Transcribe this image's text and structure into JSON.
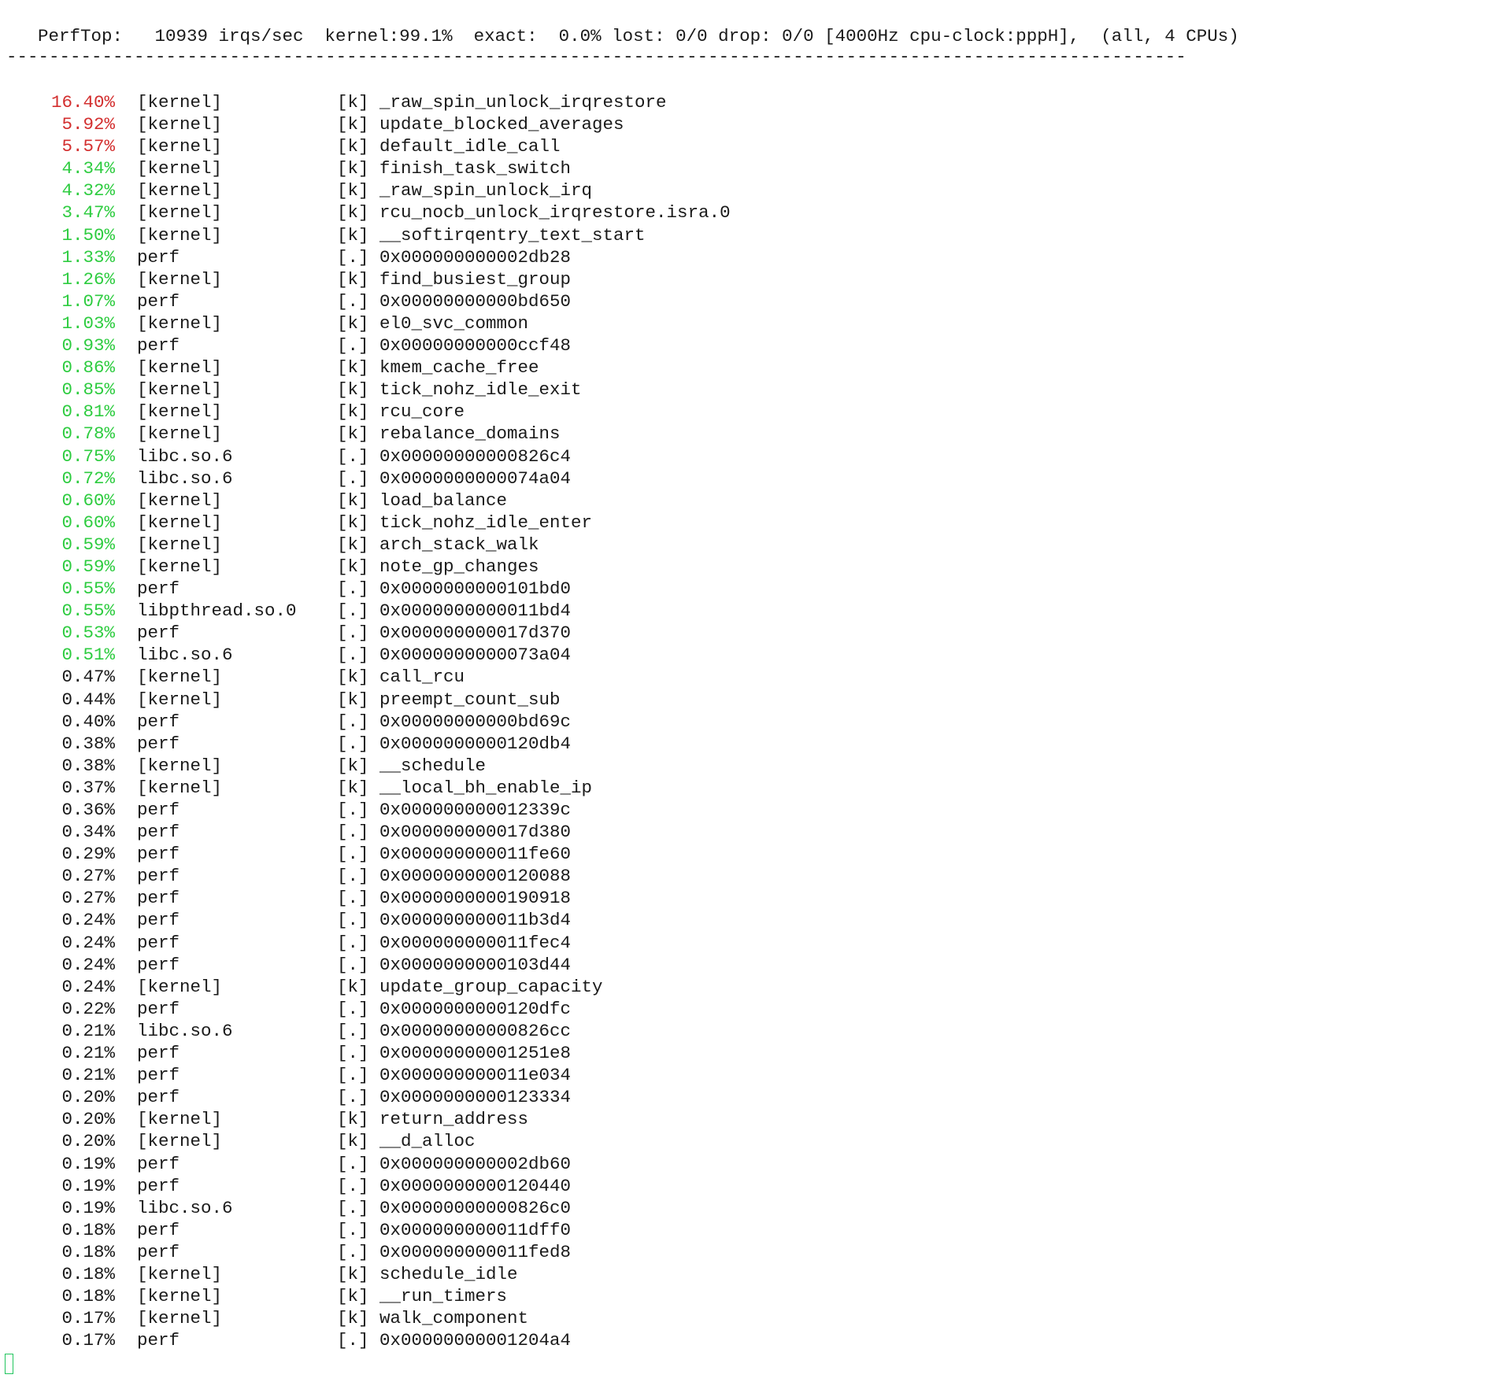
{
  "header": {
    "text": "PerfTop:   10939 irqs/sec  kernel:99.1%  exact:  0.0% lost: 0/0 drop: 0/0 [4000Hz cpu-clock:pppH],  (all, 4 CPUs)",
    "rule": "---------------------------------------------------------------------------------------------------------------"
  },
  "colors": {
    "high": "#d32f2f",
    "medium": "#2ecc40",
    "normal": "#1a1a1a",
    "cursor": "#22c55e"
  },
  "rows": [
    {
      "pct": "16.40%",
      "obj": "[kernel]",
      "typ": "[k]",
      "sym": "_raw_spin_unlock_irqrestore",
      "level": "high"
    },
    {
      "pct": "5.92%",
      "obj": "[kernel]",
      "typ": "[k]",
      "sym": "update_blocked_averages",
      "level": "high"
    },
    {
      "pct": "5.57%",
      "obj": "[kernel]",
      "typ": "[k]",
      "sym": "default_idle_call",
      "level": "high"
    },
    {
      "pct": "4.34%",
      "obj": "[kernel]",
      "typ": "[k]",
      "sym": "finish_task_switch",
      "level": "medium"
    },
    {
      "pct": "4.32%",
      "obj": "[kernel]",
      "typ": "[k]",
      "sym": "_raw_spin_unlock_irq",
      "level": "medium"
    },
    {
      "pct": "3.47%",
      "obj": "[kernel]",
      "typ": "[k]",
      "sym": "rcu_nocb_unlock_irqrestore.isra.0",
      "level": "medium"
    },
    {
      "pct": "1.50%",
      "obj": "[kernel]",
      "typ": "[k]",
      "sym": "__softirqentry_text_start",
      "level": "medium"
    },
    {
      "pct": "1.33%",
      "obj": "perf",
      "typ": "[.]",
      "sym": "0x000000000002db28",
      "level": "medium"
    },
    {
      "pct": "1.26%",
      "obj": "[kernel]",
      "typ": "[k]",
      "sym": "find_busiest_group",
      "level": "medium"
    },
    {
      "pct": "1.07%",
      "obj": "perf",
      "typ": "[.]",
      "sym": "0x00000000000bd650",
      "level": "medium"
    },
    {
      "pct": "1.03%",
      "obj": "[kernel]",
      "typ": "[k]",
      "sym": "el0_svc_common",
      "level": "medium"
    },
    {
      "pct": "0.93%",
      "obj": "perf",
      "typ": "[.]",
      "sym": "0x00000000000ccf48",
      "level": "medium"
    },
    {
      "pct": "0.86%",
      "obj": "[kernel]",
      "typ": "[k]",
      "sym": "kmem_cache_free",
      "level": "medium"
    },
    {
      "pct": "0.85%",
      "obj": "[kernel]",
      "typ": "[k]",
      "sym": "tick_nohz_idle_exit",
      "level": "medium"
    },
    {
      "pct": "0.81%",
      "obj": "[kernel]",
      "typ": "[k]",
      "sym": "rcu_core",
      "level": "medium"
    },
    {
      "pct": "0.78%",
      "obj": "[kernel]",
      "typ": "[k]",
      "sym": "rebalance_domains",
      "level": "medium"
    },
    {
      "pct": "0.75%",
      "obj": "libc.so.6",
      "typ": "[.]",
      "sym": "0x00000000000826c4",
      "level": "medium"
    },
    {
      "pct": "0.72%",
      "obj": "libc.so.6",
      "typ": "[.]",
      "sym": "0x0000000000074a04",
      "level": "medium"
    },
    {
      "pct": "0.60%",
      "obj": "[kernel]",
      "typ": "[k]",
      "sym": "load_balance",
      "level": "medium"
    },
    {
      "pct": "0.60%",
      "obj": "[kernel]",
      "typ": "[k]",
      "sym": "tick_nohz_idle_enter",
      "level": "medium"
    },
    {
      "pct": "0.59%",
      "obj": "[kernel]",
      "typ": "[k]",
      "sym": "arch_stack_walk",
      "level": "medium"
    },
    {
      "pct": "0.59%",
      "obj": "[kernel]",
      "typ": "[k]",
      "sym": "note_gp_changes",
      "level": "medium"
    },
    {
      "pct": "0.55%",
      "obj": "perf",
      "typ": "[.]",
      "sym": "0x0000000000101bd0",
      "level": "medium"
    },
    {
      "pct": "0.55%",
      "obj": "libpthread.so.0",
      "typ": "[.]",
      "sym": "0x0000000000011bd4",
      "level": "medium"
    },
    {
      "pct": "0.53%",
      "obj": "perf",
      "typ": "[.]",
      "sym": "0x000000000017d370",
      "level": "medium"
    },
    {
      "pct": "0.51%",
      "obj": "libc.so.6",
      "typ": "[.]",
      "sym": "0x0000000000073a04",
      "level": "medium"
    },
    {
      "pct": "0.47%",
      "obj": "[kernel]",
      "typ": "[k]",
      "sym": "call_rcu",
      "level": "normal"
    },
    {
      "pct": "0.44%",
      "obj": "[kernel]",
      "typ": "[k]",
      "sym": "preempt_count_sub",
      "level": "normal"
    },
    {
      "pct": "0.40%",
      "obj": "perf",
      "typ": "[.]",
      "sym": "0x00000000000bd69c",
      "level": "normal"
    },
    {
      "pct": "0.38%",
      "obj": "perf",
      "typ": "[.]",
      "sym": "0x0000000000120db4",
      "level": "normal"
    },
    {
      "pct": "0.38%",
      "obj": "[kernel]",
      "typ": "[k]",
      "sym": "__schedule",
      "level": "normal"
    },
    {
      "pct": "0.37%",
      "obj": "[kernel]",
      "typ": "[k]",
      "sym": "__local_bh_enable_ip",
      "level": "normal"
    },
    {
      "pct": "0.36%",
      "obj": "perf",
      "typ": "[.]",
      "sym": "0x000000000012339c",
      "level": "normal"
    },
    {
      "pct": "0.34%",
      "obj": "perf",
      "typ": "[.]",
      "sym": "0x000000000017d380",
      "level": "normal"
    },
    {
      "pct": "0.29%",
      "obj": "perf",
      "typ": "[.]",
      "sym": "0x000000000011fe60",
      "level": "normal"
    },
    {
      "pct": "0.27%",
      "obj": "perf",
      "typ": "[.]",
      "sym": "0x0000000000120088",
      "level": "normal"
    },
    {
      "pct": "0.27%",
      "obj": "perf",
      "typ": "[.]",
      "sym": "0x0000000000190918",
      "level": "normal"
    },
    {
      "pct": "0.24%",
      "obj": "perf",
      "typ": "[.]",
      "sym": "0x000000000011b3d4",
      "level": "normal"
    },
    {
      "pct": "0.24%",
      "obj": "perf",
      "typ": "[.]",
      "sym": "0x000000000011fec4",
      "level": "normal"
    },
    {
      "pct": "0.24%",
      "obj": "perf",
      "typ": "[.]",
      "sym": "0x0000000000103d44",
      "level": "normal"
    },
    {
      "pct": "0.24%",
      "obj": "[kernel]",
      "typ": "[k]",
      "sym": "update_group_capacity",
      "level": "normal"
    },
    {
      "pct": "0.22%",
      "obj": "perf",
      "typ": "[.]",
      "sym": "0x0000000000120dfc",
      "level": "normal"
    },
    {
      "pct": "0.21%",
      "obj": "libc.so.6",
      "typ": "[.]",
      "sym": "0x00000000000826cc",
      "level": "normal"
    },
    {
      "pct": "0.21%",
      "obj": "perf",
      "typ": "[.]",
      "sym": "0x00000000001251e8",
      "level": "normal"
    },
    {
      "pct": "0.21%",
      "obj": "perf",
      "typ": "[.]",
      "sym": "0x000000000011e034",
      "level": "normal"
    },
    {
      "pct": "0.20%",
      "obj": "perf",
      "typ": "[.]",
      "sym": "0x0000000000123334",
      "level": "normal"
    },
    {
      "pct": "0.20%",
      "obj": "[kernel]",
      "typ": "[k]",
      "sym": "return_address",
      "level": "normal"
    },
    {
      "pct": "0.20%",
      "obj": "[kernel]",
      "typ": "[k]",
      "sym": "__d_alloc",
      "level": "normal"
    },
    {
      "pct": "0.19%",
      "obj": "perf",
      "typ": "[.]",
      "sym": "0x000000000002db60",
      "level": "normal"
    },
    {
      "pct": "0.19%",
      "obj": "perf",
      "typ": "[.]",
      "sym": "0x0000000000120440",
      "level": "normal"
    },
    {
      "pct": "0.19%",
      "obj": "libc.so.6",
      "typ": "[.]",
      "sym": "0x00000000000826c0",
      "level": "normal"
    },
    {
      "pct": "0.18%",
      "obj": "perf",
      "typ": "[.]",
      "sym": "0x000000000011dff0",
      "level": "normal"
    },
    {
      "pct": "0.18%",
      "obj": "perf",
      "typ": "[.]",
      "sym": "0x000000000011fed8",
      "level": "normal"
    },
    {
      "pct": "0.18%",
      "obj": "[kernel]",
      "typ": "[k]",
      "sym": "schedule_idle",
      "level": "normal"
    },
    {
      "pct": "0.18%",
      "obj": "[kernel]",
      "typ": "[k]",
      "sym": "__run_timers",
      "level": "normal"
    },
    {
      "pct": "0.17%",
      "obj": "[kernel]",
      "typ": "[k]",
      "sym": "walk_component",
      "level": "normal"
    },
    {
      "pct": "0.17%",
      "obj": "perf",
      "typ": "[.]",
      "sym": "0x00000000001204a4",
      "level": "normal"
    }
  ]
}
